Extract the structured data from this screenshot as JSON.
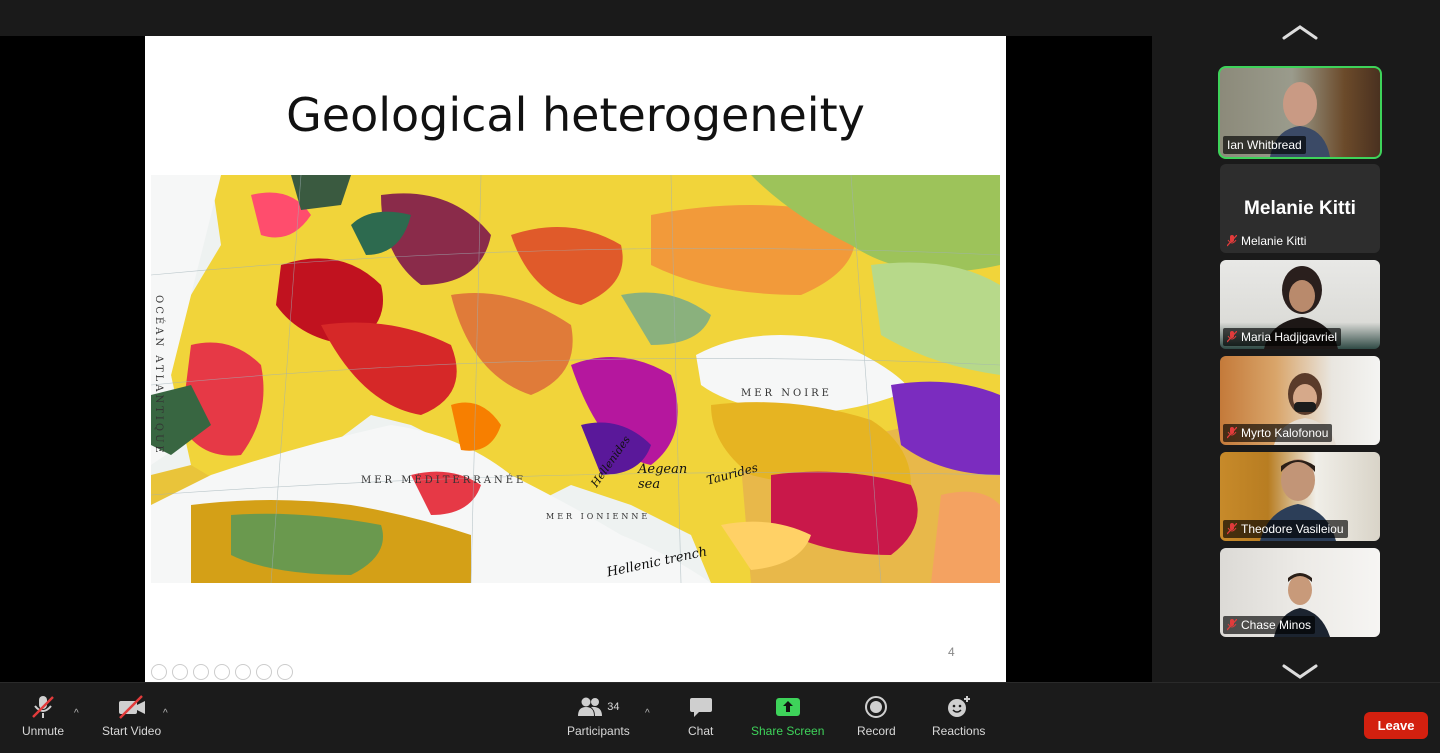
{
  "slide": {
    "title": "Geological heterogeneity",
    "page_number": "4",
    "map_labels": {
      "mer_noire": "MER NOIRE",
      "mer_mediterranee": "MER MÉDITERRANÉE",
      "aegean_sea": "Aegean sea",
      "hellenic_trench": "Hellenic trench",
      "hellenides": "Hellenides",
      "taurides": "Taurides",
      "ocean": "OCÉAN ATLANTIQUE",
      "mer_ionienne": "MER IONIENNE"
    }
  },
  "participants": [
    {
      "name": "Ian Whitbread",
      "active": true,
      "video": true
    },
    {
      "name": "Melanie Kitti",
      "video": false,
      "muted": true
    },
    {
      "name": "Maria Hadjigavriel",
      "video": true,
      "muted": true
    },
    {
      "name": "Myrto Kalofonou",
      "video": true,
      "muted": true
    },
    {
      "name": "Theodore Vasileiou",
      "video": true,
      "muted": true
    },
    {
      "name": "Chase Minos",
      "video": true,
      "muted": true
    }
  ],
  "toolbar": {
    "unmute": "Unmute",
    "start_video": "Start Video",
    "participants": "Participants",
    "participants_count": "34",
    "chat": "Chat",
    "share_screen": "Share Screen",
    "record": "Record",
    "reactions": "Reactions",
    "leave": "Leave"
  },
  "colors": {
    "accent_green": "#3ed35a",
    "leave_red": "#d3200f",
    "background": "#1a1a1a"
  }
}
